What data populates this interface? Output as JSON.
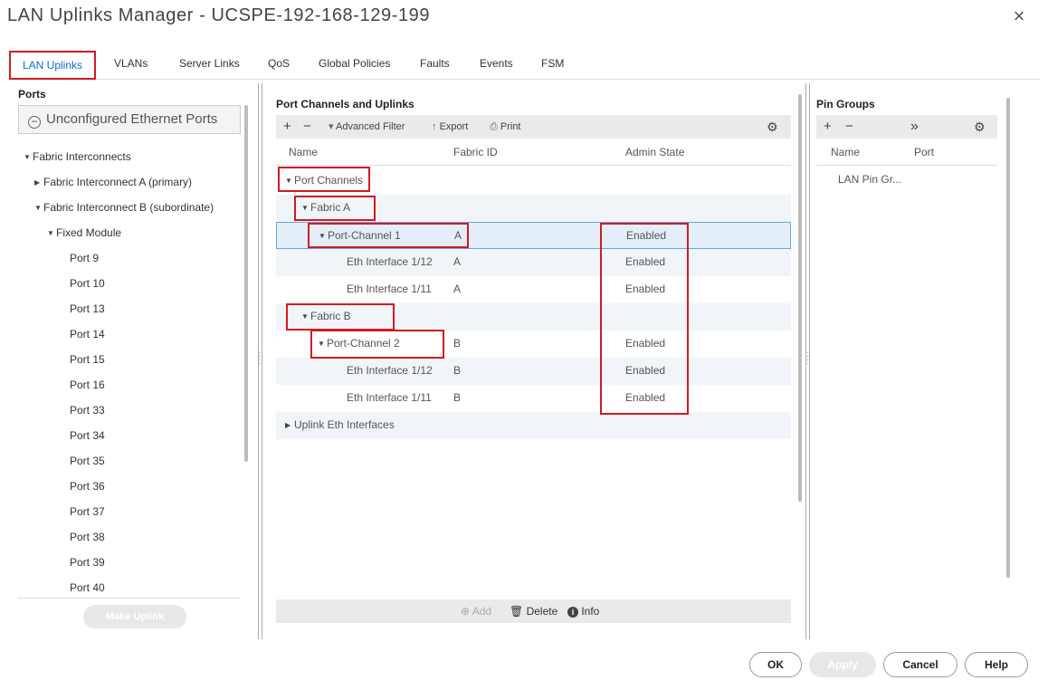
{
  "window": {
    "title": "LAN Uplinks Manager - UCSPE-192-168-129-199",
    "close_glyph": "×"
  },
  "tabs": [
    "LAN Uplinks",
    "VLANs",
    "Server Links",
    "QoS",
    "Global Policies",
    "Faults",
    "Events",
    "FSM"
  ],
  "left": {
    "title": "Ports",
    "unconfigured_button": "Unconfigured Ethernet Ports",
    "tree": {
      "fabric_interconnects": "Fabric Interconnects",
      "fi_a": "Fabric Interconnect A (primary)",
      "fi_b": "Fabric Interconnect B (subordinate)",
      "fixed_module": "Fixed Module",
      "ports": [
        "Port 9",
        "Port 10",
        "Port 13",
        "Port 14",
        "Port 15",
        "Port 16",
        "Port 33",
        "Port 34",
        "Port 35",
        "Port 36",
        "Port 37",
        "Port 38",
        "Port 39",
        "Port 40"
      ]
    },
    "make_uplink": "Make Uplink"
  },
  "middle": {
    "title": "Port Channels and Uplinks",
    "toolbar": {
      "add": "+",
      "remove": "−",
      "advanced_filter": "Advanced Filter",
      "export": "Export",
      "print": "Print"
    },
    "columns": [
      "Name",
      "Fabric ID",
      "Admin State"
    ],
    "rows": {
      "port_channels": "Port Channels",
      "fabric_a": "Fabric A",
      "pc1": {
        "name": "Port-Channel 1",
        "fabric": "A",
        "state": "Enabled"
      },
      "pc1_eth12": {
        "name": "Eth Interface 1/12",
        "fabric": "A",
        "state": "Enabled"
      },
      "pc1_eth11": {
        "name": "Eth Interface 1/11",
        "fabric": "A",
        "state": "Enabled"
      },
      "fabric_b": "Fabric B",
      "pc2": {
        "name": "Port-Channel 2",
        "fabric": "B",
        "state": "Enabled"
      },
      "pc2_eth12": {
        "name": "Eth Interface 1/12",
        "fabric": "B",
        "state": "Enabled"
      },
      "pc2_eth11": {
        "name": "Eth Interface 1/11",
        "fabric": "B",
        "state": "Enabled"
      },
      "uplink_eth": "Uplink Eth Interfaces"
    },
    "bottom": {
      "add": "Add",
      "delete": "Delete",
      "info": "Info"
    }
  },
  "right": {
    "title": "Pin Groups",
    "toolbar": {
      "add": "+",
      "remove": "−",
      "more": "»"
    },
    "columns": [
      "Name",
      "Port"
    ],
    "rows": [
      {
        "name": "LAN Pin Gr..."
      }
    ]
  },
  "footer": {
    "ok": "OK",
    "apply": "Apply",
    "cancel": "Cancel",
    "help": "Help"
  },
  "colors": {
    "accent": "#0a6ed1",
    "highlight": "#d21a22",
    "selected_row": "#e3eef9"
  }
}
